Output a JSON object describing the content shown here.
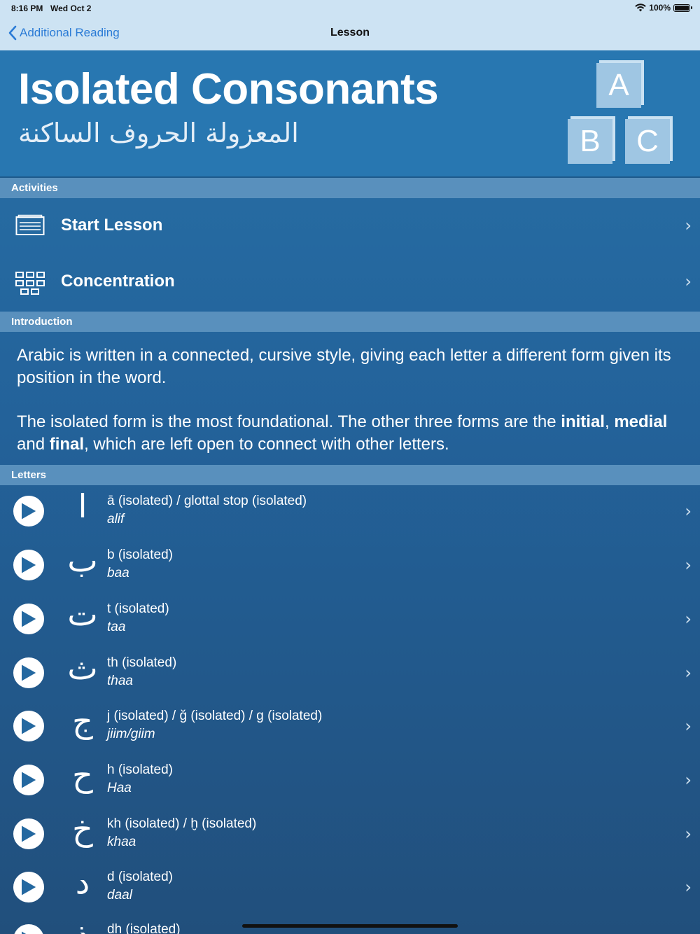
{
  "status": {
    "time": "8:16 PM",
    "date": "Wed Oct 2",
    "battery": "100%"
  },
  "nav": {
    "back_label": "Additional Reading",
    "title": "Lesson"
  },
  "header": {
    "title": "Isolated Consonants",
    "arabic_title": "المعزولة الحروف الساكنة",
    "blocks": [
      "A",
      "B",
      "C"
    ]
  },
  "sections": {
    "activities": "Activities",
    "introduction": "Introduction",
    "letters": "Letters"
  },
  "activities": [
    {
      "label": "Start Lesson",
      "icon": "lesson-card-icon"
    },
    {
      "label": "Concentration",
      "icon": "grid-icon"
    }
  ],
  "intro": {
    "p1": "Arabic is written in a connected, cursive style, giving each letter a different form given its position in the word.",
    "p2_a": "The isolated form is the most foundational. The other three forms are the ",
    "p2_initial": "initial",
    "p2_b": ", ",
    "p2_medial": "medial",
    "p2_c": " and ",
    "p2_final": "final",
    "p2_d": ", which are left open to connect with other letters."
  },
  "letters": [
    {
      "glyph": "ا",
      "title": "ā (isolated) / glottal stop (isolated)",
      "name": "alif"
    },
    {
      "glyph": "ب",
      "title": "b (isolated)",
      "name": "baa"
    },
    {
      "glyph": "ت",
      "title": "t (isolated)",
      "name": "taa"
    },
    {
      "glyph": "ث",
      "title": "th  (isolated)",
      "name": "thaa"
    },
    {
      "glyph": "ج",
      "title": "j (isolated) / ğ (isolated) / g (isolated)",
      "name": "jiim/giim"
    },
    {
      "glyph": "ح",
      "title": "h (isolated)",
      "name": "Haa"
    },
    {
      "glyph": "خ",
      "title": "kh (isolated) / ḫ (isolated)",
      "name": "khaa"
    },
    {
      "glyph": "د",
      "title": "d (isolated)",
      "name": "daal"
    },
    {
      "glyph": "ذ",
      "title": "dh (isolated)",
      "name": ""
    }
  ]
}
